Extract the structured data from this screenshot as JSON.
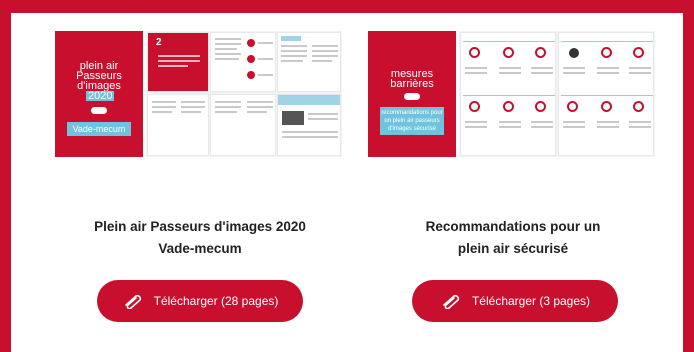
{
  "theme": {
    "accent": "#c8102e",
    "info_blue": "#6fc3df",
    "text": "#222222"
  },
  "documents": [
    {
      "cover_lines": [
        "plein air",
        "Passeurs",
        "d'images",
        "2020"
      ],
      "cover_band": "Vade-mecum",
      "title_line1": "Plein air Passeurs d'images 2020",
      "title_line2": "Vade-mecum",
      "download_label": "Télécharger (28 pages)",
      "download_icon": "paperclip-icon",
      "page_number": "2"
    },
    {
      "cover_lines": [
        "mesures",
        "barrières"
      ],
      "cover_band": "recommandations pour un plein air passeurs d'images sécurisé",
      "title_line1": "Recommandations pour un",
      "title_line2": "plein air sécurisé",
      "download_label": "Télécharger (3 pages)",
      "download_icon": "paperclip-icon"
    }
  ]
}
